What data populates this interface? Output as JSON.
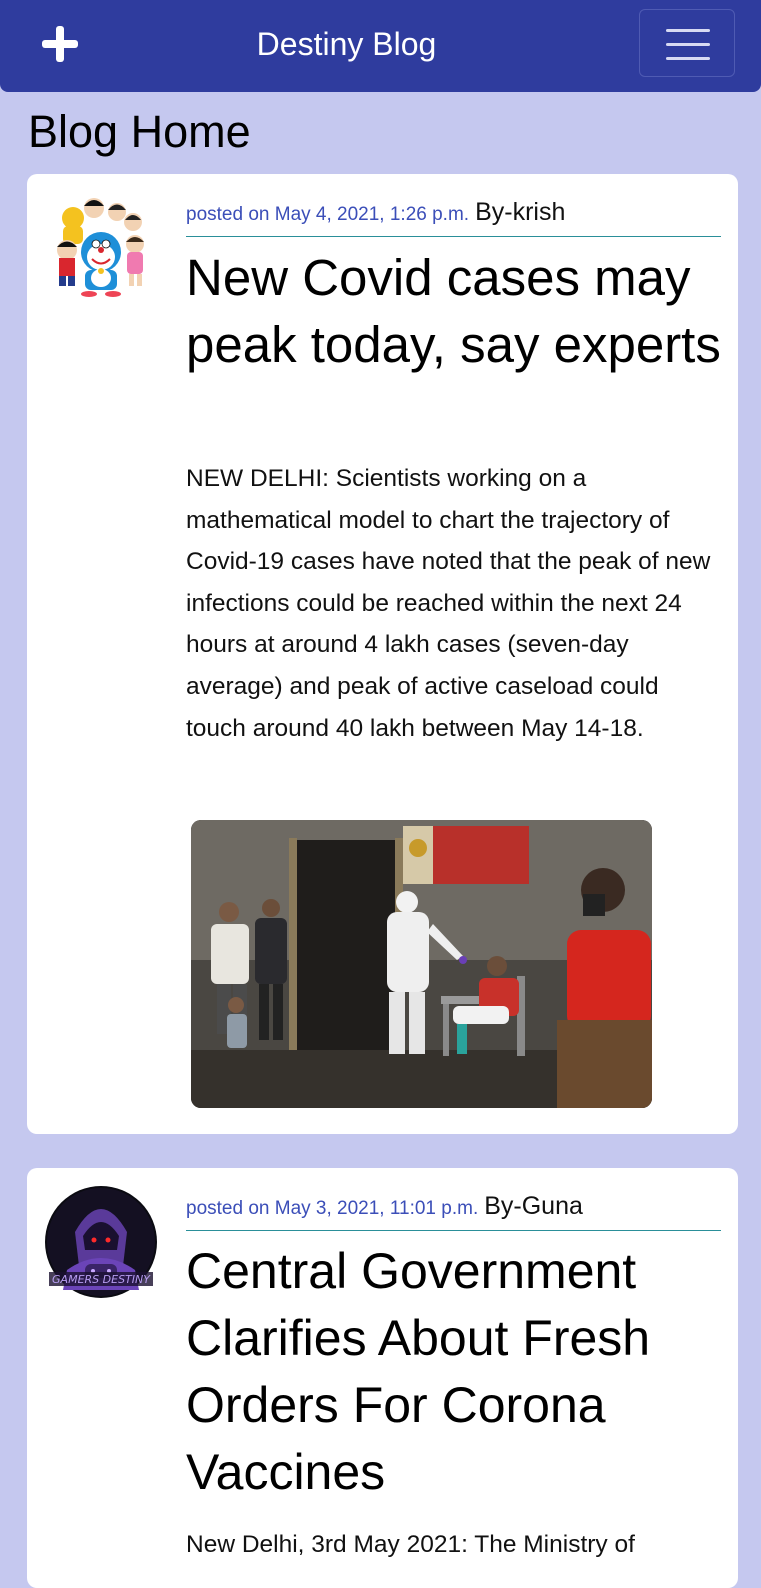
{
  "navbar": {
    "brand": "Destiny Blog",
    "add_icon": "plus-icon",
    "menu_icon": "hamburger-menu-icon"
  },
  "page": {
    "title": "Blog Home"
  },
  "posts": [
    {
      "posted": "posted on May 4, 2021, 1:26 p.m.",
      "author": "By-krish",
      "title": "New Covid cases may peak today, say experts",
      "excerpt": "NEW DELHI: Scientists working on a mathematical model to chart the trajectory of Covid-19 cases have noted that the peak of new infections could be reached within the next 24 hours at around 4 lakh cases (seven-day average) and peak of active caseload could touch around 40 lakh between May 14-18."
    },
    {
      "posted": "posted on May 3, 2021, 11:01 p.m.",
      "author": "By-Guna",
      "title": "Central Government Clarifies About Fresh Orders For Corona Vaccines",
      "excerpt": "New Delhi, 3rd May 2021: The Ministry of"
    }
  ],
  "colors": {
    "navbar": "#2f3c9e",
    "background": "#c5c8ef",
    "meta_link": "#3b4eb8",
    "divider": "#2a8f99"
  }
}
